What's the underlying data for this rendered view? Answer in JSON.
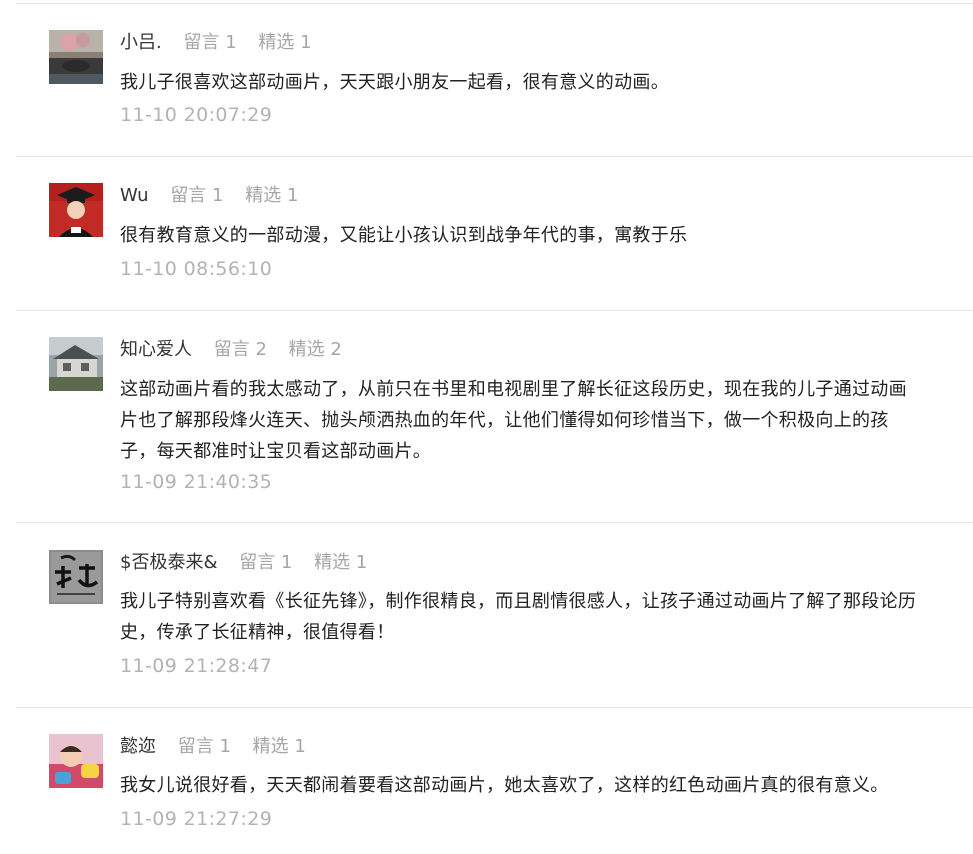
{
  "comments": [
    {
      "nickname": "小吕.",
      "reply_count": "留言 1",
      "featured_count": "精选 1",
      "content": "我儿子很喜欢这部动画片，天天跟小朋友一起看，很有意义的动画。",
      "time": "11-10 20:07:29",
      "avatar": "landscape-avatar"
    },
    {
      "nickname": "Wu",
      "reply_count": "留言 1",
      "featured_count": "精选 1",
      "content": "很有教育意义的一部动漫，又能让小孩认识到战争年代的事，寓教于乐",
      "time": "11-10 08:56:10",
      "avatar": "child-graduation-avatar"
    },
    {
      "nickname": "知心爱人",
      "reply_count": "留言 2",
      "featured_count": "精选 2",
      "content": "这部动画片看的我太感动了，从前只在书里和电视剧里了解长征这段历史，现在我的儿子通过动画片也了解那段烽火连天、抛头颅洒热血的年代，让他们懂得如何珍惜当下，做一个积极向上的孩子，每天都准时让宝贝看这部动画片。",
      "time": "11-09 21:40:35",
      "avatar": "house-avatar"
    },
    {
      "nickname": "$否极泰来&",
      "reply_count": "留言 1",
      "featured_count": "精选 1",
      "content": "我儿子特别喜欢看《长征先锋》，制作很精良，而且剧情很感人，让孩子通过动画片了解了那段论历史，传承了长征精神，很值得看！",
      "time": "11-09 21:28:47",
      "avatar": "calligraphy-avatar"
    },
    {
      "nickname": "懿迩",
      "reply_count": "留言 1",
      "featured_count": "精选 1",
      "content": "我女儿说很好看，天天都闹着要看这部动画片，她太喜欢了，这样的红色动画片真的很有意义。",
      "time": "11-09 21:27:29",
      "avatar": "toddler-avatar"
    }
  ]
}
